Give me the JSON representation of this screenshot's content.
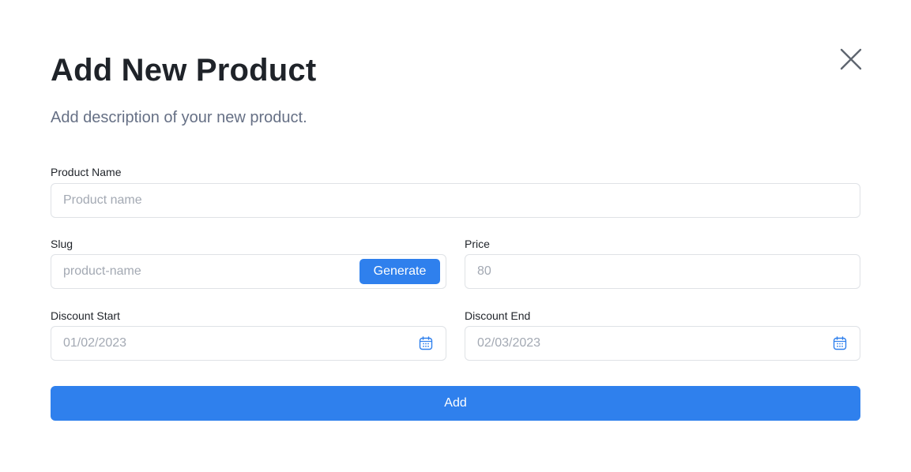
{
  "header": {
    "title": "Add New Product",
    "subtitle": "Add description of your new product."
  },
  "close_icon": "close-icon",
  "form": {
    "product_name": {
      "label": "Product Name",
      "value": "",
      "placeholder": "Product name"
    },
    "slug": {
      "label": "Slug",
      "value": "",
      "placeholder": "product-name",
      "generate_label": "Generate"
    },
    "price": {
      "label": "Price",
      "value": "",
      "placeholder": "80"
    },
    "discount_start": {
      "label": "Discount Start",
      "value": "",
      "placeholder": "01/02/2023",
      "icon": "calendar-icon"
    },
    "discount_end": {
      "label": "Discount End",
      "value": "",
      "placeholder": "02/03/2023",
      "icon": "calendar-icon"
    }
  },
  "actions": {
    "add_label": "Add"
  },
  "colors": {
    "accent": "#2f80ed",
    "title": "#1f2329",
    "subtitle": "#667085",
    "placeholder": "#a3a9b3",
    "border": "#dfe2e6"
  }
}
